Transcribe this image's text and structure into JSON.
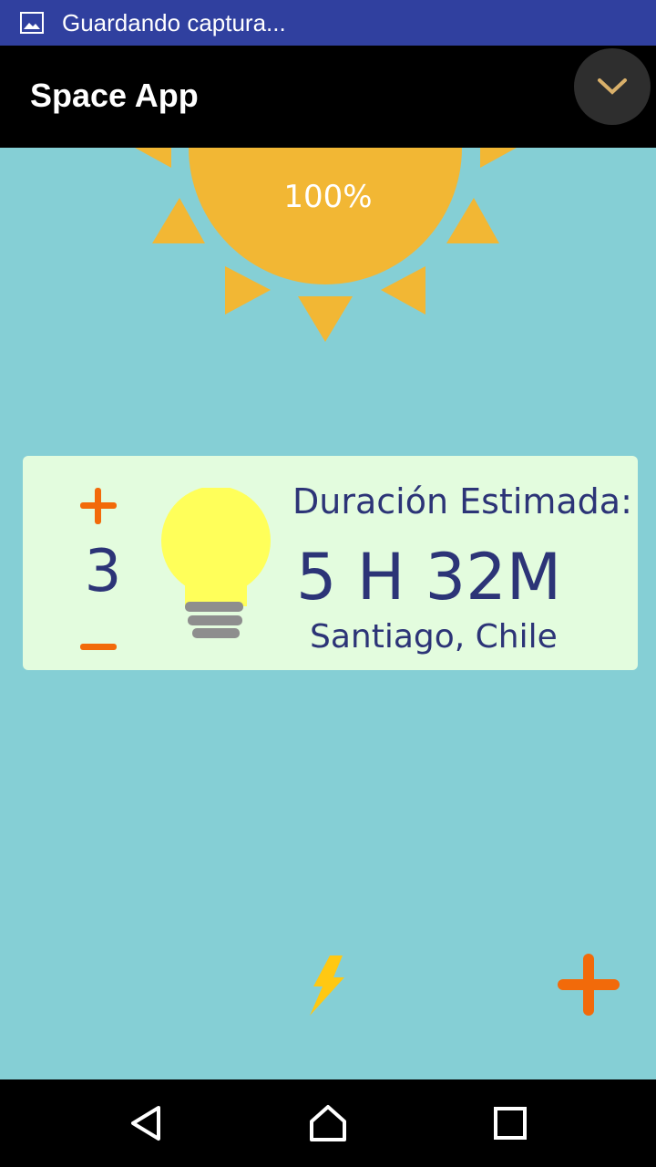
{
  "status_bar": {
    "text": "Guardando captura..."
  },
  "app_bar": {
    "title": "Space App"
  },
  "sun": {
    "percent": "100%"
  },
  "card": {
    "count": "3",
    "duration_label": "Duración Estimada:",
    "duration_value": "5 H 32M",
    "location": "Santiago, Chile"
  },
  "icons": {
    "status": "image-icon",
    "collapse": "chevron-down-icon",
    "increase": "plus-icon",
    "decrease": "minus-icon",
    "bulb": "lightbulb-icon",
    "energy": "lightning-bolt-icon",
    "add": "plus-icon",
    "back": "back-icon",
    "home": "home-icon",
    "recents": "recents-icon"
  },
  "colors": {
    "background": "#85cfd5",
    "sun": "#f2b734",
    "accent_orange": "#f26a0a",
    "text_dark": "#2c3477",
    "card": "#e3fcde",
    "bulb": "#ffff5a",
    "bolt": "#ffc812",
    "status_bar": "#30409f"
  }
}
